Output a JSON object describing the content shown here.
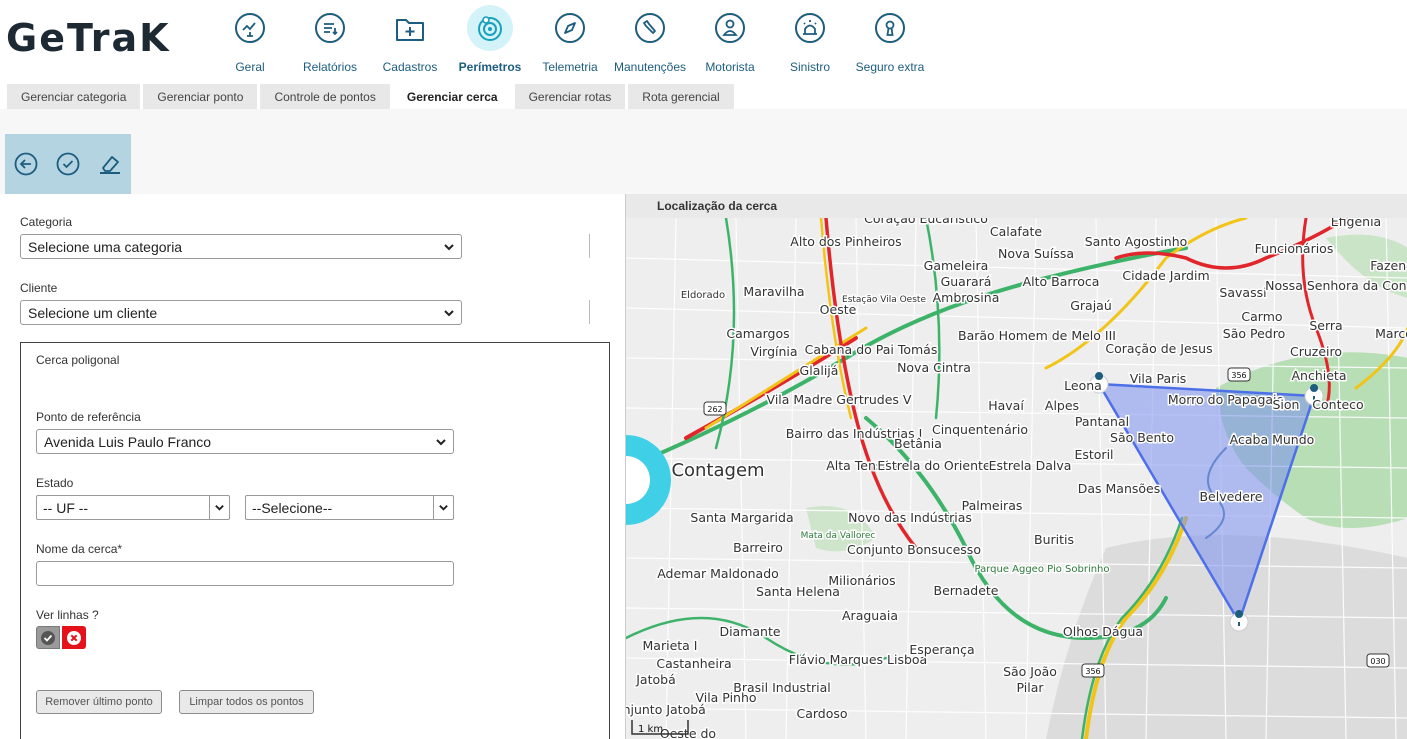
{
  "app": {
    "logo": "GeTraK"
  },
  "nav": [
    {
      "label": "Geral",
      "icon": "monitor-chart-icon"
    },
    {
      "label": "Relatórios",
      "icon": "report-icon"
    },
    {
      "label": "Cadastros",
      "icon": "folder-plus-icon"
    },
    {
      "label": "Perímetros",
      "icon": "perimeter-icon",
      "active": true
    },
    {
      "label": "Telemetria",
      "icon": "compass-icon"
    },
    {
      "label": "Manutenções",
      "icon": "wrench-icon"
    },
    {
      "label": "Motorista",
      "icon": "driver-icon"
    },
    {
      "label": "Sinistro",
      "icon": "siren-icon"
    },
    {
      "label": "Seguro extra",
      "icon": "keyhole-icon"
    }
  ],
  "tabs": [
    {
      "label": "Gerenciar categoria"
    },
    {
      "label": "Gerenciar ponto"
    },
    {
      "label": "Controle de pontos"
    },
    {
      "label": "Gerenciar cerca",
      "active": true
    },
    {
      "label": "Gerenciar rotas"
    },
    {
      "label": "Rota gerencial"
    }
  ],
  "toolbar": {
    "back_icon": "back-icon",
    "confirm_icon": "check-circle-icon",
    "erase_icon": "eraser-icon"
  },
  "form": {
    "categoria_label": "Categoria",
    "categoria_value": "Selecione uma categoria",
    "cliente_label": "Cliente",
    "cliente_value": "Selecione um cliente",
    "poly_title": "Cerca poligonal",
    "ponto_label": "Ponto de referência",
    "ponto_value": "Avenida Luis Paulo Franco",
    "estado_label": "Estado",
    "uf_value": "-- UF --",
    "cidade_value": "--Selecione--",
    "nome_label": "Nome da cerca*",
    "nome_value": "",
    "linhas_label": "Ver linhas ?",
    "remover_label": "Remover último ponto",
    "limpar_label": "Limpar todos os pontos"
  },
  "map": {
    "title": "Localização da cerca",
    "scale": "1 km",
    "colors": {
      "fence_fill": "#7b8ff0",
      "fence_stroke": "#4d6fe8",
      "road_green": "#3db36a",
      "road_yellow": "#f2c418",
      "road_red": "#e0262b",
      "park": "#a9d9a6"
    },
    "shields": [
      "262",
      "356",
      "356",
      "030"
    ],
    "places": [
      "Coração Eucarístico",
      "Calafate",
      "Alto dos Pinheiros",
      "Santo Agostinho",
      "Funcionários",
      "Efigênia",
      "Nova Suíssa",
      "Gameleira",
      "Guarará",
      "Ambrosina",
      "Alto Barroca",
      "Cidade Jardim",
      "Savassi",
      "Fazenda",
      "Nossa Senhora da Conceição",
      "Eldorado",
      "Maravilha",
      "Oeste",
      "Estação Vila Oeste",
      "Grajaú",
      "Barão Homem de Melo III",
      "Carmo",
      "Serra",
      "Camargos",
      "Virgínia",
      "Cabana do Pai Tomás",
      "Coração de Jesus",
      "São Pedro",
      "Cruzeiro",
      "Marco",
      "Glalijá",
      "Nova Cintra",
      "Leona",
      "Vila Paris",
      "Anchieta",
      "Vila Madre Gertrudes V",
      "Havaí",
      "Alpes",
      "Morro do Papagaio",
      "Sion",
      "Conteco",
      "Bairro das Indústrias I",
      "Betânia",
      "Cinquentenário",
      "Pantanal",
      "São Bento",
      "Acaba Mundo",
      "Contagem",
      "Alta Tensão",
      "Estrela do Oriente",
      "Estrela Dalva",
      "Estoril",
      "Das Mansões",
      "Belvedere",
      "Palmeiras",
      "Santa Margarida",
      "Barreiro",
      "Novo das Indústrias",
      "Mata da Vallorec",
      "Conjunto Bonsucesso",
      "Buritis",
      "Parque Aggeo Pio Sobrinho",
      "Ademar Maldonado",
      "Santa Helena",
      "Milionários",
      "Bernadete",
      "Araguaia",
      "Diamante",
      "Olhos Dágua",
      "Marieta I",
      "Castanheira",
      "Flávio Marques Lisboa",
      "Esperança",
      "São João",
      "Pilar",
      "Jatobá",
      "Brasil Industrial",
      "Vila Pinho",
      "Cardoso",
      "Conjunto Jatobá",
      "Oeste do"
    ]
  }
}
